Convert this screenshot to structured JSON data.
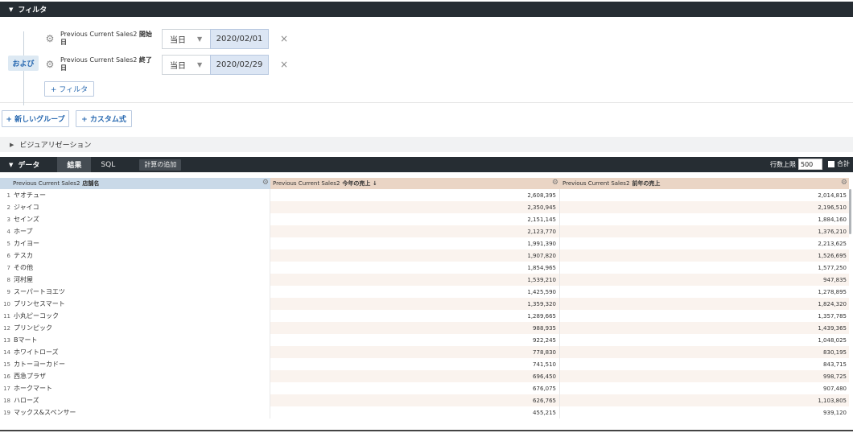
{
  "filter_section": {
    "title": "フィルタ",
    "and_label": "および",
    "filters": [
      {
        "name_prefix": "Previous Current Sales2 ",
        "name_bold": "開始日",
        "operator": "当日",
        "value": "2020/02/01"
      },
      {
        "name_prefix": "Previous Current Sales2 ",
        "name_bold": "終了日",
        "operator": "当日",
        "value": "2020/02/29"
      }
    ],
    "add_filter_label": "+ フィルタ",
    "remove_icon": "×"
  },
  "group_buttons": {
    "new_group": "+ 新しいグループ",
    "custom_expr": "+ カスタム式"
  },
  "visualization": {
    "title": "ビジュアリゼーション"
  },
  "data_section": {
    "title": "データ",
    "tabs": [
      "結果",
      "SQL"
    ],
    "add_calc": "計算の追加",
    "row_limit_label": "行数上限",
    "row_limit_value": "500",
    "total_label": "合計"
  },
  "table": {
    "columns": [
      {
        "prefix": "Previous Current Sales2 ",
        "bold": "店舗名"
      },
      {
        "prefix": "Previous Current Sales2 ",
        "bold": "今年の売上 ↓"
      },
      {
        "prefix": "Previous Current Sales2 ",
        "bold": "前年の売上"
      }
    ],
    "rows": [
      {
        "n": "1",
        "store": "ヤオチュー",
        "this_year": "2,608,395",
        "last_year": "2,014,815"
      },
      {
        "n": "2",
        "store": "ジャイコ",
        "this_year": "2,350,945",
        "last_year": "2,196,510"
      },
      {
        "n": "3",
        "store": "セインズ",
        "this_year": "2,151,145",
        "last_year": "1,884,160"
      },
      {
        "n": "4",
        "store": "ホープ",
        "this_year": "2,123,770",
        "last_year": "1,376,210"
      },
      {
        "n": "5",
        "store": "カイヨー",
        "this_year": "1,991,390",
        "last_year": "2,213,625"
      },
      {
        "n": "6",
        "store": "テスカ",
        "this_year": "1,907,820",
        "last_year": "1,526,695"
      },
      {
        "n": "7",
        "store": "その他",
        "this_year": "1,854,965",
        "last_year": "1,577,250"
      },
      {
        "n": "8",
        "store": "河村屋",
        "this_year": "1,539,210",
        "last_year": "947,835"
      },
      {
        "n": "9",
        "store": "スーパートヨエツ",
        "this_year": "1,425,590",
        "last_year": "1,278,895"
      },
      {
        "n": "10",
        "store": "プリンセスマート",
        "this_year": "1,359,320",
        "last_year": "1,824,320"
      },
      {
        "n": "11",
        "store": "小丸ピーコック",
        "this_year": "1,289,665",
        "last_year": "1,357,785"
      },
      {
        "n": "12",
        "store": "プリンピック",
        "this_year": "988,935",
        "last_year": "1,439,365"
      },
      {
        "n": "13",
        "store": "Bマート",
        "this_year": "922,245",
        "last_year": "1,048,025"
      },
      {
        "n": "14",
        "store": "ホワイトローズ",
        "this_year": "778,830",
        "last_year": "830,195"
      },
      {
        "n": "15",
        "store": "カトーヨーカドー",
        "this_year": "741,510",
        "last_year": "843,715"
      },
      {
        "n": "16",
        "store": "西急プラザ",
        "this_year": "696,450",
        "last_year": "998,725"
      },
      {
        "n": "17",
        "store": "ホークマート",
        "this_year": "676,075",
        "last_year": "907,480"
      },
      {
        "n": "18",
        "store": "ハローズ",
        "this_year": "626,765",
        "last_year": "1,103,805"
      },
      {
        "n": "19",
        "store": "マックス&スペンサー",
        "this_year": "455,215",
        "last_year": "939,120"
      }
    ]
  },
  "colors": {
    "dark_bar": "#262d33",
    "accent_blue": "#2a6ab1",
    "header_blue": "#c9d9e8",
    "header_tan": "#ead5c5"
  }
}
